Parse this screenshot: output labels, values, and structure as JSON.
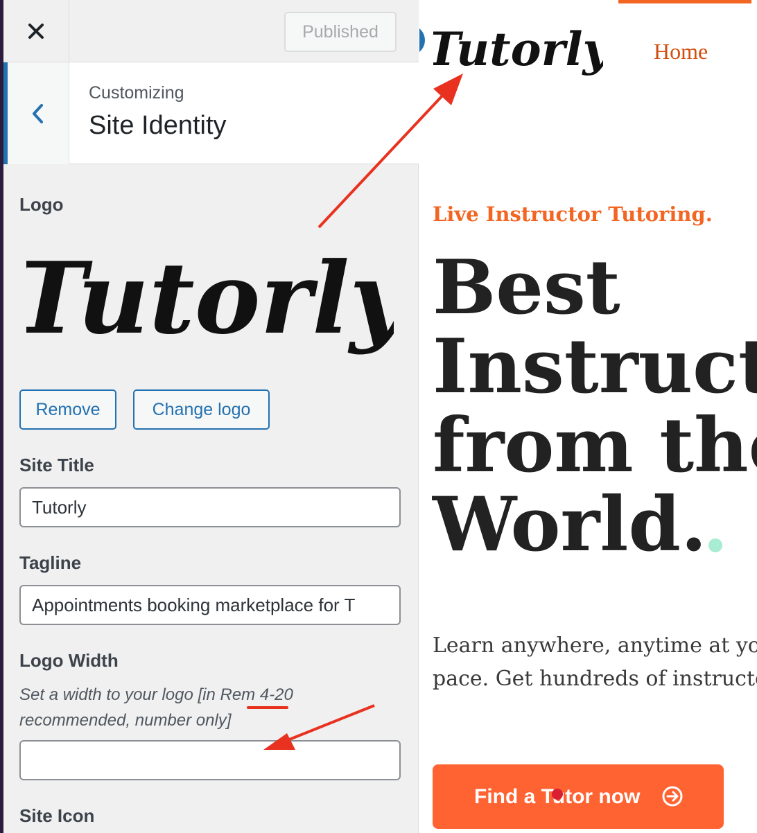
{
  "customizer": {
    "published_label": "Published",
    "breadcrumb": "Customizing",
    "section_title": "Site Identity",
    "logo_label": "Logo",
    "logo_text": "Tutorly",
    "remove_label": "Remove",
    "change_logo_label": "Change logo",
    "site_title_label": "Site Title",
    "site_title_value": "Tutorly",
    "tagline_label": "Tagline",
    "tagline_value": "Appointments booking marketplace for T",
    "logo_width_label": "Logo Width",
    "logo_width_desc": "Set a width to your logo [in Rem 4-20 recommended, number only]",
    "logo_width_value": "",
    "site_icon_label": "Site Icon"
  },
  "preview": {
    "logo_text": "Tutorly",
    "nav_home": "Home",
    "kicker": "Live Instructor Tutoring.",
    "headline_lines": [
      "Best",
      "Instructors",
      "from the",
      "World."
    ],
    "lede_lines": [
      "Learn anywhere, anytime at your",
      "pace. Get hundreds of instructors"
    ],
    "cta_label": "Find a Tutor now"
  },
  "icons": {
    "close": "close-icon",
    "back": "chevron-left-icon",
    "cta": "arrow-circle-right-icon"
  },
  "colors": {
    "accent": "#2271b1",
    "brand": "#f26522",
    "cta": "#ff6331",
    "annotation": "#e8321f"
  }
}
